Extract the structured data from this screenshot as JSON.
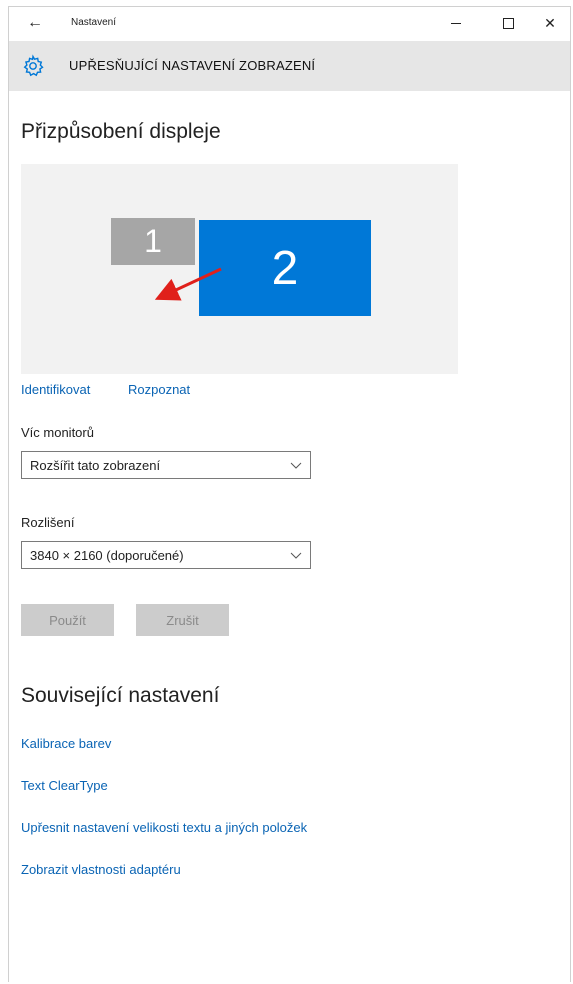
{
  "titlebar": {
    "title": "Nastavení",
    "back_icon": "arrow-left-icon",
    "minimize_icon": "minimize-icon",
    "maximize_icon": "maximize-icon",
    "close_icon": "close-icon"
  },
  "header": {
    "icon": "gear-icon",
    "title": "UPŘESŇUJÍCÍ NASTAVENÍ ZOBRAZENÍ"
  },
  "display": {
    "section_title": "Přizpůsobení displeje",
    "monitor1_label": "1",
    "monitor2_label": "2",
    "identify_link": "Identifikovat",
    "detect_link": "Rozpoznat",
    "monitor2_color": "#0078d7",
    "monitor1_color": "#a6a6a6",
    "arrow_color": "#e0201b"
  },
  "multiple_monitors": {
    "label": "Víc monitorů",
    "value": "Rozšířit tato zobrazení"
  },
  "resolution": {
    "label": "Rozlišení",
    "value": "3840 × 2160 (doporučené)"
  },
  "buttons": {
    "apply": "Použít",
    "cancel": "Zrušit"
  },
  "related": {
    "title": "Související nastavení",
    "links": [
      "Kalibrace barev",
      "Text ClearType",
      "Upřesnit nastavení velikosti textu a jiných položek",
      "Zobrazit vlastnosti adaptéru"
    ]
  },
  "colors": {
    "accent": "#0078d7",
    "link": "#0a64b4",
    "header_bg": "#e6e6e6"
  }
}
